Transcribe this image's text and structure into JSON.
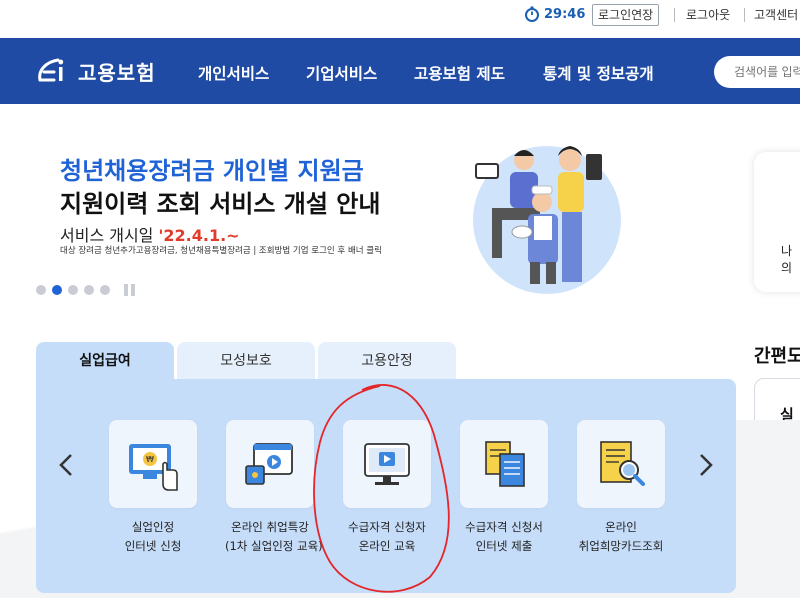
{
  "utility": {
    "timer": "29:46",
    "extend_label": "로그인연장",
    "logout_label": "로그아웃",
    "support_label": "고객센터"
  },
  "nav": {
    "logo_text": "고용보험",
    "items": [
      "개인서비스",
      "기업서비스",
      "고용보험 제도",
      "통계 및 정보공개"
    ],
    "search_placeholder": "검색어를 입력"
  },
  "banner": {
    "title_line1": "청년채용장려금 개인별 지원금",
    "title_line2": "지원이력 조회 서비스 개설 안내",
    "date_prefix": "서비스 개시일 ",
    "date_value": "'22.4.1.~",
    "note": "대상 장려금 청년추가고용장려금, 청년채용특별장려금 | 조회방법 기업 로그인 후 배너 클릭",
    "slide_count": 5,
    "active_slide": 2
  },
  "side": {
    "card_text": "나의",
    "section_title": "간편도",
    "box_tab": "실업"
  },
  "tabs": {
    "items": [
      "실업급여",
      "모성보호",
      "고용안정"
    ],
    "active": 0
  },
  "services": [
    {
      "line1": "실업인정",
      "line2": "인터넷 신청",
      "icon": "monitor-hand-icon"
    },
    {
      "line1": "온라인 취업특강",
      "line2": "(1차 실업인정 교육)",
      "icon": "video-lecture-icon"
    },
    {
      "line1": "수급자격 신청자",
      "line2": "온라인 교육",
      "icon": "online-education-icon"
    },
    {
      "line1": "수급자격 신청서",
      "line2": "인터넷 제출",
      "icon": "documents-icon"
    },
    {
      "line1": "온라인",
      "line2": "취업희망카드조회",
      "icon": "document-search-icon"
    }
  ],
  "colors": {
    "brand_blue": "#1f4ba5",
    "accent_blue": "#1f63d6",
    "panel_bg": "#c5ddf9",
    "highlight_red": "#e23b2a",
    "annotation_red": "#e4262a"
  }
}
